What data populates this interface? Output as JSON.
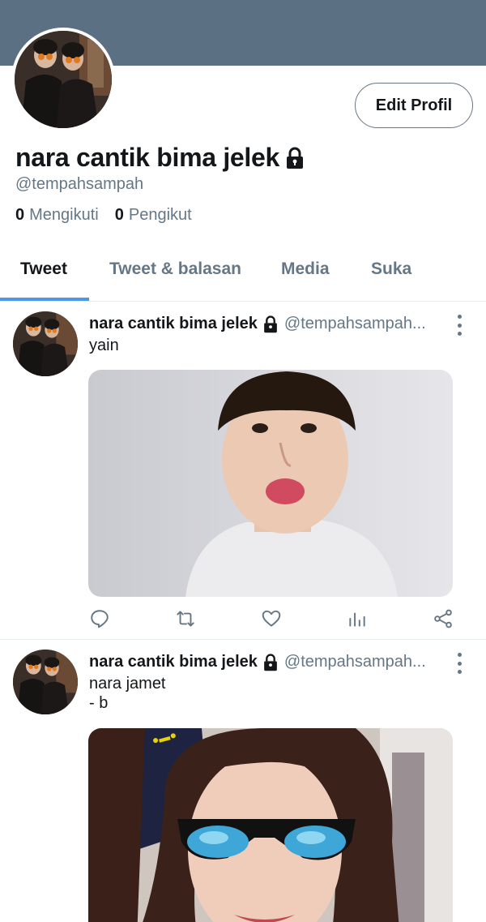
{
  "profile": {
    "name": "nara cantik bima jelek",
    "handle": "@tempahsampah",
    "edit_button": "Edit Profil",
    "following_count": "0",
    "following_label": "Mengikuti",
    "followers_count": "0",
    "followers_label": "Pengikut",
    "banner_color": "#5b7083"
  },
  "tabs": [
    {
      "label": "Tweet",
      "active": true
    },
    {
      "label": "Tweet & balasan",
      "active": false
    },
    {
      "label": "Media",
      "active": false
    },
    {
      "label": "Suka",
      "active": false
    }
  ],
  "accent_color": "#4a99e9",
  "tweets": [
    {
      "author": "nara cantik bima jelek",
      "handle": "@tempahsampah...",
      "text_lines": [
        "yain"
      ],
      "actions": [
        "reply-icon",
        "retweet-icon",
        "like-icon",
        "analytics-icon",
        "share-icon"
      ]
    },
    {
      "author": "nara cantik bima jelek",
      "handle": "@tempahsampah...",
      "text_lines": [
        "nara jamet",
        "- b"
      ]
    }
  ]
}
